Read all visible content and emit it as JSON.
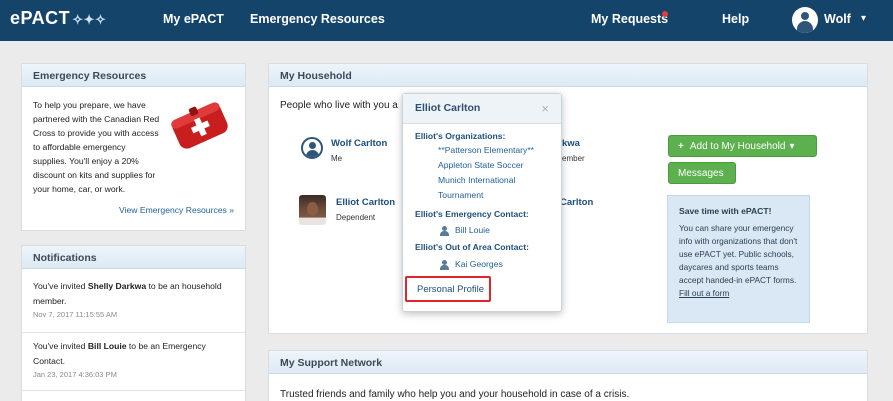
{
  "nav": {
    "logo": "ePACT",
    "my_epact": "My ePACT",
    "emergency_resources": "Emergency Resources",
    "my_requests": "My Requests",
    "help": "Help",
    "user_name": "Wolf"
  },
  "emergency_resources": {
    "title": "Emergency Resources",
    "text": "To help you prepare, we have partnered with the Canadian Red Cross to provide you with access to affordable emergency supplies. You'll enjoy a 20% discount on kits and supplies for your home, car, or work.",
    "link": "View Emergency Resources »"
  },
  "notifications": {
    "title": "Notifications",
    "items": [
      {
        "pre": "You've invited ",
        "name": "Shelly Darkwa",
        "post": " to be an household member.",
        "time": "Nov 7, 2017 11:15:55 AM"
      },
      {
        "pre": "You've invited ",
        "name": "Bill Louie",
        "post": " to be an Emergency Contact.",
        "time": "Jan 23, 2017 4:36:03 PM"
      }
    ]
  },
  "household": {
    "title": "My Household",
    "intro": "People who live with you a",
    "members": [
      {
        "name": "Wolf Carlton",
        "role": "Me"
      },
      {
        "name": "Elliot Carlton",
        "role": "Dependent"
      },
      {
        "name": "kwa",
        "role": "ember"
      },
      {
        "name": "Carlton",
        "role": ""
      }
    ],
    "add_button": "Add to My Household",
    "messages_button": "Messages",
    "tip": {
      "title": "Save time with ePACT!",
      "body": "You can share your emergency info with organizations that don't use ePACT yet. Public schools, daycares and sports teams accept handed-in ePACT forms. ",
      "link": "Fill out a form"
    }
  },
  "support_network": {
    "title": "My Support Network",
    "text": "Trusted friends and family who help you and your household in case of a crisis."
  },
  "popover": {
    "title": "Elliot Carlton",
    "organizations_label": "Elliot's Organizations:",
    "organizations": [
      "**Patterson Elementary**",
      "Appleton State Soccer",
      "Munich International",
      "Tournament"
    ],
    "emergency_label": "Elliot's Emergency Contact:",
    "emergency_contact": "Bill Louie",
    "out_of_area_label": "Elliot's Out of Area Contact:",
    "out_of_area_contact": "Kai Georges",
    "profile_button": "Personal Profile"
  },
  "colors": {
    "nav_bg": "#15446b",
    "accent_green": "#5cb04d",
    "link_blue": "#1f5f9c",
    "highlight_red": "#e2242b"
  }
}
